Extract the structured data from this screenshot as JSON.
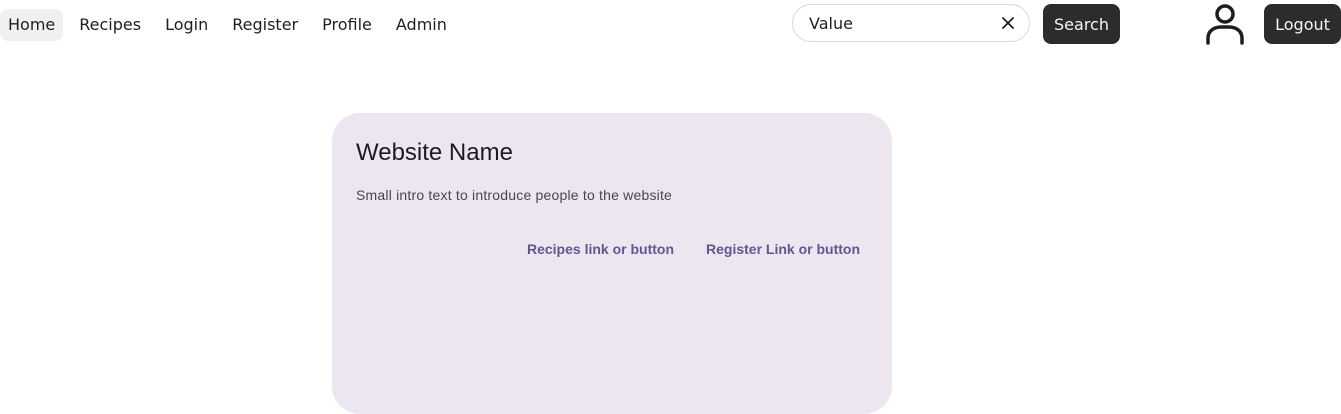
{
  "nav": {
    "items": [
      {
        "label": "Home",
        "active": true
      },
      {
        "label": "Recipes",
        "active": false
      },
      {
        "label": "Login",
        "active": false
      },
      {
        "label": "Register",
        "active": false
      },
      {
        "label": "Profile",
        "active": false
      },
      {
        "label": "Admin",
        "active": false
      }
    ]
  },
  "search": {
    "value": "Value",
    "button_label": "Search"
  },
  "header": {
    "avatar_icon": "user-icon",
    "logout_label": "Logout"
  },
  "card": {
    "title": "Website Name",
    "intro": "Small intro text to introduce people to the website",
    "actions": [
      {
        "label": "Recipes link or button"
      },
      {
        "label": "Register Link or button"
      }
    ]
  },
  "colors": {
    "button_bg": "#2c2c2c",
    "card_bg": "#ece6f0",
    "link": "#65558f"
  }
}
